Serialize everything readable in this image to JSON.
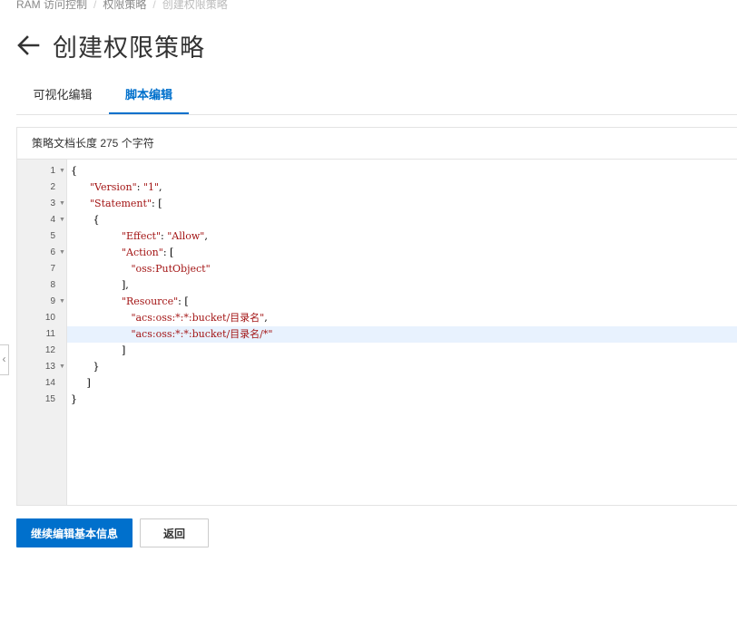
{
  "breadcrumb": {
    "items": [
      "RAM 访问控制",
      "权限策略"
    ],
    "current": "创建权限策略"
  },
  "header": {
    "back_icon": "arrow-left-icon",
    "title": "创建权限策略"
  },
  "tabs": [
    {
      "label": "可视化编辑",
      "active": false
    },
    {
      "label": "脚本编辑",
      "active": true
    }
  ],
  "editor": {
    "info": "策略文档长度 275 个字符",
    "active_line": 11,
    "lines": [
      {
        "num": "1",
        "fold": true,
        "text": "{"
      },
      {
        "num": "2",
        "fold": false,
        "text": "      \"Version\": \"1\","
      },
      {
        "num": "3",
        "fold": true,
        "text": "      \"Statement\": ["
      },
      {
        "num": "4",
        "fold": true,
        "text": "       {"
      },
      {
        "num": "5",
        "fold": false,
        "text": "                \"Effect\": \"Allow\","
      },
      {
        "num": "6",
        "fold": true,
        "text": "                \"Action\": ["
      },
      {
        "num": "7",
        "fold": false,
        "text": "                   \"oss:PutObject\""
      },
      {
        "num": "8",
        "fold": false,
        "text": "                ],"
      },
      {
        "num": "9",
        "fold": true,
        "text": "                \"Resource\": ["
      },
      {
        "num": "10",
        "fold": false,
        "text": "                   \"acs:oss:*:*:bucket/目录名\","
      },
      {
        "num": "11",
        "fold": false,
        "text": "                   \"acs:oss:*:*:bucket/目录名/*\""
      },
      {
        "num": "12",
        "fold": false,
        "text": "                ]"
      },
      {
        "num": "13",
        "fold": true,
        "text": "       }"
      },
      {
        "num": "14",
        "fold": false,
        "text": "     ]"
      },
      {
        "num": "15",
        "fold": false,
        "text": "}"
      }
    ]
  },
  "buttons": {
    "continue": "继续编辑基本信息",
    "back": "返回"
  },
  "colors": {
    "primary": "#0070cc",
    "string": "#a31515",
    "active_line": "#e8f2fe"
  }
}
